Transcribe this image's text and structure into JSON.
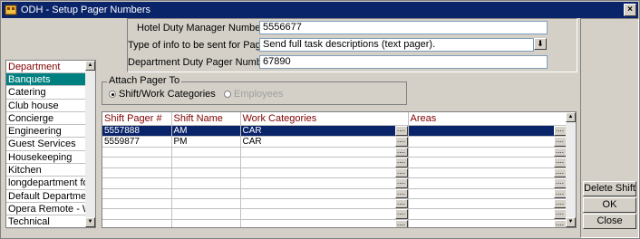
{
  "window": {
    "title": "ODH - Setup Pager Numbers",
    "close_label": "×"
  },
  "form": {
    "hotel_duty_label": "Hotel Duty Manager Number",
    "hotel_duty_value": "5556677",
    "info_type_label": "Type of info to be sent for Paging",
    "info_type_value": "Send full task descriptions (text pager).",
    "dept_pager_label": "Department Duty Pager Number",
    "dept_pager_value": "67890"
  },
  "departments": {
    "header": "Department",
    "items": [
      "Banquets",
      "Catering",
      "Club house",
      "Concierge",
      "Engineering",
      "Guest Services",
      "Housekeeping",
      "Kitchen",
      "longdepartment for te",
      "Default Department",
      "Opera Remote - Wire",
      "Technical"
    ],
    "selected_index": 0
  },
  "attach": {
    "legend": "Attach Pager To",
    "option1": "Shift/Work Categories",
    "option2": "Employees",
    "selected": "option1"
  },
  "shifts": {
    "columns": [
      "Shift Pager #",
      "Shift Name",
      "Work Categories",
      "Areas"
    ],
    "rows": [
      [
        "5557888",
        "AM",
        "CAR",
        ""
      ],
      [
        "5559877",
        "PM",
        "CAR",
        ""
      ],
      [
        "",
        "",
        "",
        ""
      ],
      [
        "",
        "",
        "",
        ""
      ],
      [
        "",
        "",
        "",
        ""
      ],
      [
        "",
        "",
        "",
        ""
      ],
      [
        "",
        "",
        "",
        ""
      ],
      [
        "",
        "",
        "",
        ""
      ],
      [
        "",
        "",
        "",
        ""
      ],
      [
        "",
        "",
        "",
        ""
      ]
    ],
    "ellipsis": "...."
  },
  "buttons": {
    "delete_shift": "Delete Shift",
    "ok": "OK",
    "close": "Close"
  },
  "colors": {
    "titlebar": "#0a246a",
    "selection": "#0a246a",
    "dept_selection": "#008080",
    "header_text": "#800000"
  },
  "icons": {
    "app": "hotel-app-icon",
    "dropdown": "dropdown-arrow-icon"
  }
}
